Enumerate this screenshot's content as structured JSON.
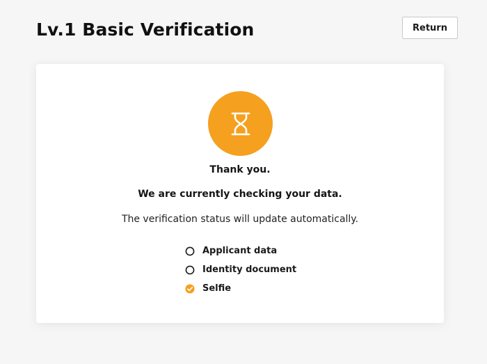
{
  "header": {
    "title": "Lv.1 Basic Verification",
    "return_label": "Return"
  },
  "card": {
    "status_icon": "hourglass-icon",
    "thanks": "Thank you.",
    "checking": "We are currently checking your data.",
    "auto_update": "The verification status will update automatically.",
    "steps": [
      {
        "label": "Applicant data",
        "status": "pending",
        "icon": "empty-circle-icon"
      },
      {
        "label": "Identity document",
        "status": "pending",
        "icon": "empty-circle-icon"
      },
      {
        "label": "Selfie",
        "status": "complete",
        "icon": "check-circle-icon"
      }
    ]
  },
  "colors": {
    "accent": "#f5a01f",
    "text": "#111111",
    "card_bg": "#ffffff",
    "page_bg": "#f6f6f7"
  }
}
